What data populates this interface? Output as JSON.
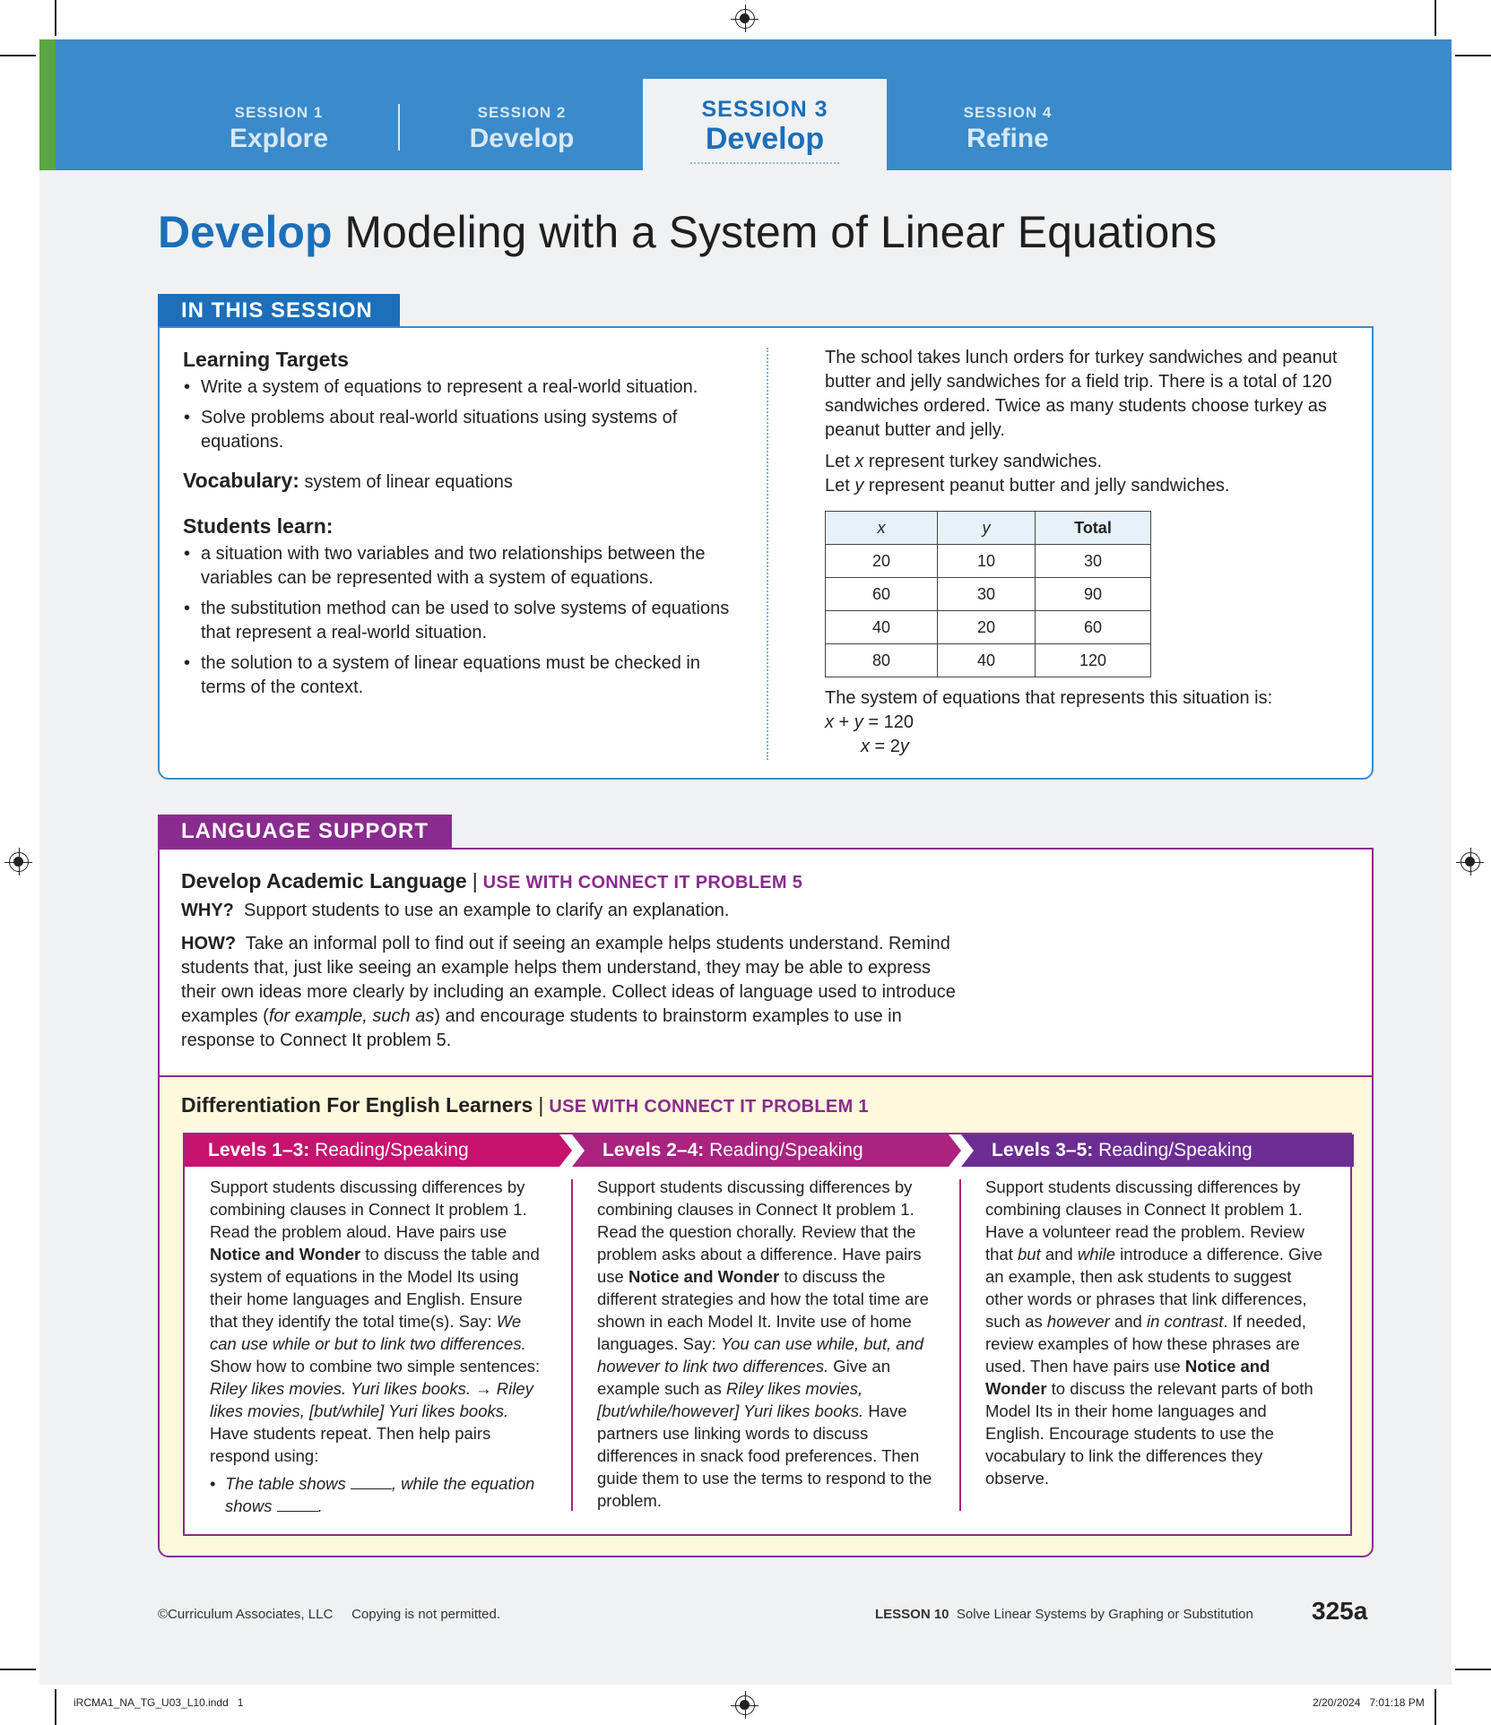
{
  "sessions": [
    {
      "num": "SESSION 1",
      "name": "Explore"
    },
    {
      "num": "SESSION 2",
      "name": "Develop"
    },
    {
      "num": "SESSION 3",
      "name": "Develop"
    },
    {
      "num": "SESSION 4",
      "name": "Refine"
    }
  ],
  "colors": {
    "blue": "#1c6fb8",
    "band": "#3b8acb",
    "purple": "#8a2b8f",
    "green": "#5aa541",
    "magenta": "#c6136e",
    "violet": "#6c2d92"
  },
  "title": {
    "accent": "Develop",
    "rest": " Modeling with a System of Linear Equations"
  },
  "in_this_session": {
    "label": "IN THIS SESSION",
    "learning_targets_heading": "Learning Targets",
    "learning_targets": [
      "Write a system of equations to represent a real-world situation.",
      "Solve problems about real-world situations using systems of equations."
    ],
    "vocabulary_label": "Vocabulary:",
    "vocabulary_value": "system of linear equations",
    "students_learn_heading": "Students learn:",
    "students_learn": [
      "a situation with two variables and two relationships between the variables can be represented with a system of equations.",
      "the substitution method can be used to solve systems of equations that represent a real-world situation.",
      "the solution to a system of linear equations must be checked in terms of the context."
    ],
    "problem": "The school takes lunch orders for turkey sandwiches and peanut butter and jelly sandwiches for a field trip. There is a total of 120 sandwiches ordered. Twice as many students choose turkey as peanut butter and jelly.",
    "let_x_pre": "Let ",
    "let_x_var": "x",
    "let_x_post": " represent turkey sandwiches.",
    "let_y_pre": "Let ",
    "let_y_var": "y",
    "let_y_post": " represent peanut butter and jelly sandwiches.",
    "table": {
      "headers": [
        "x",
        "y",
        "Total"
      ],
      "rows": [
        [
          "20",
          "10",
          "30"
        ],
        [
          "60",
          "30",
          "90"
        ],
        [
          "40",
          "20",
          "60"
        ],
        [
          "80",
          "40",
          "120"
        ]
      ]
    },
    "system_intro": "The system of equations that represents this situation is:",
    "eq1": {
      "a": "x",
      "op1": " + ",
      "b": "y",
      "rest": " = 120"
    },
    "eq2": {
      "a": "x",
      "mid": " = 2",
      "b": "y"
    }
  },
  "language_support": {
    "label": "LANGUAGE SUPPORT",
    "heading": "Develop Academic Language",
    "sep": "|",
    "use_with": "USE WITH CONNECT IT PROBLEM 5",
    "why_label": "WHY?",
    "why_text": "Support students to use an example to clarify an explanation.",
    "how_label": "HOW?",
    "how_text_1": "Take an informal poll to find out if seeing an example helps students understand. Remind students that, just like seeing an example helps them understand, they may be able to express their own ideas more clearly by including an example. Collect ideas of language used to introduce examples (",
    "how_italic": "for example, such as",
    "how_text_2": ") and encourage students to brainstorm examples to use in response to Connect It problem 5."
  },
  "differentiation": {
    "heading": "Differentiation For English Learners",
    "sep": "|",
    "use_with": "USE WITH CONNECT IT PROBLEM 1",
    "levels": [
      {
        "level": "Levels 1–3:",
        "skill": " Reading/Speaking"
      },
      {
        "level": "Levels 2–4:",
        "skill": " Reading/Speaking"
      },
      {
        "level": "Levels 3–5:",
        "skill": " Reading/Speaking"
      }
    ],
    "col1": {
      "t1": "Support students discussing differences by combining clauses in Connect It problem 1. Read the problem aloud. Have pairs use ",
      "b1": "Notice and Wonder",
      "t2": " to discuss the table and system of equations in the Model Its using their home languages and English. Ensure that they identify the total time(s). Say: ",
      "i1": "We can use while or but to link two differences.",
      "t3": " Show how to combine two simple sentences: ",
      "i2": "Riley likes movies. Yuri likes books. → Riley likes movies, [but/while] Yuri likes books.",
      "t4": " Have students repeat. Then help pairs respond using:",
      "bullet_a": "The table shows ",
      "bullet_b": ", while the equation shows ",
      "bullet_c": "."
    },
    "col2": {
      "t1": "Support students discussing differences by combining clauses in Connect It problem 1. Read the question chorally. Review that the problem asks about a difference. Have pairs use ",
      "b1": "Notice and Wonder",
      "t2": " to discuss the different strategies and how the total time are shown in each Model It. Invite use of home languages.  Say: ",
      "i1": "You can use while, but, and however to link two differences.",
      "t3": " Give an example such as ",
      "i2": "Riley likes movies, [but/while/however] Yuri likes books.",
      "t4": " Have partners use linking words to discuss differences in snack food preferences. Then guide them to use the terms to respond to the problem."
    },
    "col3": {
      "t1": "Support students discussing differences by combining clauses in Connect It problem 1. Have a volunteer read the problem. Review that ",
      "i1": "but",
      "t2": " and ",
      "i2": "while",
      "t3": " introduce a difference. Give an example, then ask students to suggest other words or phrases that link differences, such as ",
      "i3": "however",
      "t4": " and ",
      "i4": "in contrast",
      "t5": ". If needed, review examples of how these phrases are used. Then have pairs use ",
      "b1": "Notice and Wonder",
      "t6": " to discuss the relevant parts of both Model Its in their home languages and English. Encourage students to use the vocabulary to link the differences they observe."
    }
  },
  "footer": {
    "copyright": "©Curriculum Associates, LLC     Copying is not permitted.",
    "lesson_label": "LESSON 10",
    "lesson_title": "  Solve Linear Systems by Graphing or Substitution",
    "page": "325a",
    "slug_left": "iRCMA1_NA_TG_U03_L10.indd   1",
    "slug_right": "2/20/2024   7:01:18 PM"
  }
}
